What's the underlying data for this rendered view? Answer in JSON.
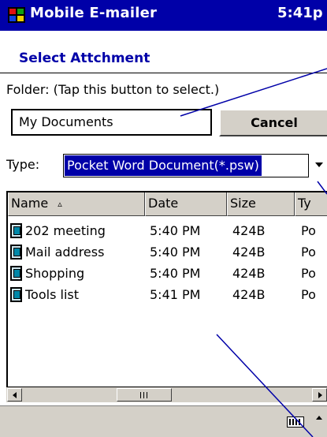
{
  "titlebar": {
    "app_name": "Mobile E-mailer",
    "time": "5:41p"
  },
  "dialog": {
    "heading": "Select Attchment",
    "folder_label": "Folder: (Tap this button to select.)",
    "folder_value": "My Documents",
    "cancel_label": "Cancel",
    "type_label": "Type:",
    "type_value": "Pocket Word Document(*.psw)"
  },
  "file_list": {
    "columns": [
      "Name",
      "Date",
      "Size",
      "Ty"
    ],
    "sort_column": "Name",
    "sort_icon": "▵",
    "rows": [
      {
        "name": "202 meeting",
        "date": "5:40 PM",
        "size": "424B",
        "type": "Po"
      },
      {
        "name": "Mail address",
        "date": "5:40 PM",
        "size": "424B",
        "type": "Po"
      },
      {
        "name": "Shopping",
        "date": "5:40 PM",
        "size": "424B",
        "type": "Po"
      },
      {
        "name": "Tools list",
        "date": "5:41 PM",
        "size": "424B",
        "type": "Po"
      }
    ]
  },
  "icons": {
    "app_logo": "windows-flag-icon",
    "file": "pocket-word-document-icon",
    "keyboard": "keyboard-icon"
  },
  "colors": {
    "title_bar": "#0000a8",
    "heading": "#0000a8",
    "selection": "#0000a8",
    "chrome": "#d4d0c8",
    "annotation_line": "#0000a8"
  }
}
